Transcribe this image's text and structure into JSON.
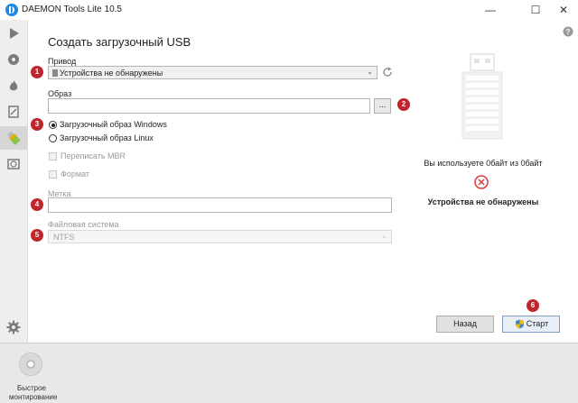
{
  "window": {
    "title": "DAEMON Tools Lite 10.5",
    "minimize": "—",
    "maximize": "☐",
    "close": "✕"
  },
  "sidebar": {
    "items": [
      {
        "icon": "play-icon"
      },
      {
        "icon": "disc-icon"
      },
      {
        "icon": "flame-icon"
      },
      {
        "icon": "image-edit-icon"
      },
      {
        "icon": "usb-stick-icon",
        "active": true
      },
      {
        "icon": "virtual-drive-icon"
      }
    ],
    "settings_icon": "gear-icon"
  },
  "main": {
    "title": "Создать загрузочный USB",
    "help": "?",
    "drive": {
      "label": "Привод",
      "value": "Устройства не обнаружены",
      "marker": "1"
    },
    "image": {
      "label": "Образ",
      "value": "",
      "browse": "...",
      "marker": "2"
    },
    "boot_type": {
      "marker": "3",
      "options": [
        "Загрузочный образ Windows",
        "Загрузочный образ Linux"
      ],
      "selected": "Загрузочный образ Windows"
    },
    "rewrite_mbr": {
      "label": "Переписать MBR",
      "checked": false,
      "enabled": false
    },
    "format": {
      "label": "Формат",
      "checked": false,
      "enabled": false
    },
    "volume_label": {
      "label": "Метка",
      "value": "",
      "marker": "4"
    },
    "filesystem": {
      "label": "Файловая система",
      "value": "NTFS",
      "marker": "5",
      "enabled": false
    },
    "usage": "Вы используете 0байт из 0байт",
    "status": "Устройства не обнаружены",
    "back": "Назад",
    "start": "Старт",
    "start_marker": "6"
  },
  "footer": {
    "quick_mount_line1": "Быстрое",
    "quick_mount_line2": "монтирование"
  },
  "colors": {
    "marker": "#c0262d",
    "error_icon": "#d23c3c",
    "accent": "#1e88e5"
  }
}
